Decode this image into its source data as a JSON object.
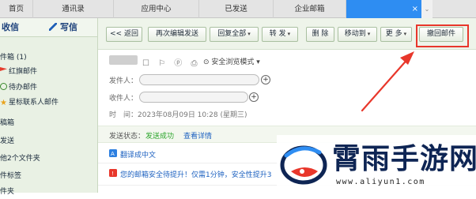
{
  "tabs": [
    {
      "label": "首页"
    },
    {
      "label": "通讯录"
    },
    {
      "label": "应用中心"
    },
    {
      "label": "已发送"
    },
    {
      "label": "企业邮箱"
    },
    {
      "label": ""
    }
  ],
  "tab_close": "×",
  "tab_more": "⌄",
  "sidebar": {
    "receive": "收信",
    "write": "写信",
    "folders": [
      {
        "label": "件箱 (1)",
        "icon": "none"
      },
      {
        "label": "红旗邮件",
        "icon": "red-flag-icon"
      },
      {
        "label": "待办邮件",
        "icon": "clock-icon"
      },
      {
        "label": "星标联系人邮件",
        "icon": "star-icon"
      },
      {
        "label": "稿箱",
        "icon": "none"
      },
      {
        "label": "发送",
        "icon": "none"
      },
      {
        "label": "他2个文件夹",
        "icon": "none"
      },
      {
        "label": "件标签",
        "icon": "none"
      },
      {
        "label": "件夹",
        "icon": "none"
      }
    ]
  },
  "toolbar": {
    "back": "<< 返回",
    "reedit": "再次编辑发送",
    "reply_all": "回复全部",
    "forward": "转 发",
    "delete": "删 除",
    "move_to": "移动到",
    "more": "更 多",
    "recall": "撤回邮件",
    "caret": "▾"
  },
  "mail": {
    "header_icons": "☐ ⚐ ⓟ ⎙",
    "safe_view": "⊙ 安全浏览模式",
    "safe_view_caret": "▾",
    "sender_label": "发件人：",
    "recipient_label": "收件人：",
    "time_label": "时　间：",
    "time_value": "2023年08月09日 10:28 (星期三)",
    "plus": "+"
  },
  "status": {
    "label": "发送状态：",
    "value": "发送成功",
    "link": "查看详情"
  },
  "translate": {
    "label": "翻译成中文"
  },
  "notice": {
    "text": "您的邮箱安全待提升！仅需1分钟，安全性提升3"
  },
  "watermark": {
    "title": "霄雨手游网",
    "url": "www.aliyun1.com"
  },
  "colors": {
    "tab_active": "#2e8df2",
    "sidebar_bg": "#e9f1e4",
    "toolbar_bg": "#eef4ea",
    "highlight": "#e8372b",
    "success": "#2aa52a",
    "link": "#1e62c0",
    "brand_dark": "#0e2554"
  }
}
